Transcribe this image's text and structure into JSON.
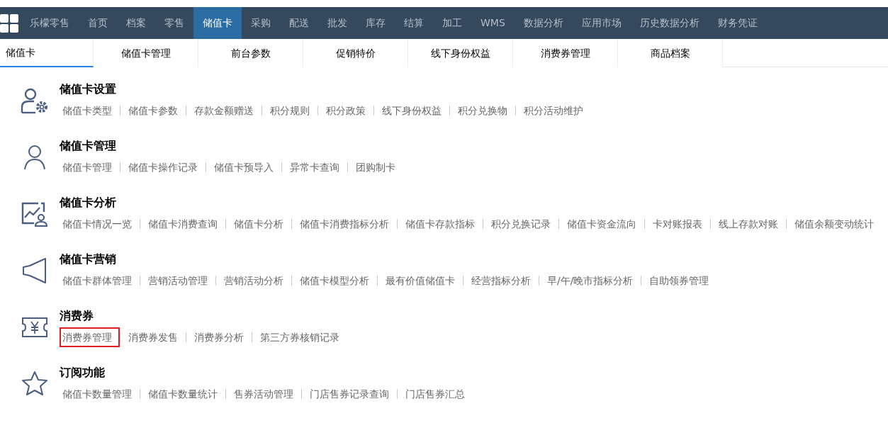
{
  "navbar": {
    "brand": "乐檬零售",
    "items": [
      {
        "label": "首页",
        "selected": false
      },
      {
        "label": "档案",
        "selected": false
      },
      {
        "label": "零售",
        "selected": false
      },
      {
        "label": "储值卡",
        "selected": true
      },
      {
        "label": "采购",
        "selected": false
      },
      {
        "label": "配送",
        "selected": false
      },
      {
        "label": "批发",
        "selected": false
      },
      {
        "label": "库存",
        "selected": false
      },
      {
        "label": "结算",
        "selected": false
      },
      {
        "label": "加工",
        "selected": false
      },
      {
        "label": "WMS",
        "selected": false
      },
      {
        "label": "数据分析",
        "selected": false
      },
      {
        "label": "应用市场",
        "selected": false
      },
      {
        "label": "历史数据分析",
        "selected": false
      },
      {
        "label": "财务凭证",
        "selected": false
      }
    ]
  },
  "tabs": [
    {
      "label": "储值卡",
      "selected": true
    },
    {
      "label": "储值卡管理",
      "selected": false
    },
    {
      "label": "前台参数",
      "selected": false
    },
    {
      "label": "促销特价",
      "selected": false
    },
    {
      "label": "线下身份权益",
      "selected": false
    },
    {
      "label": "消费券管理",
      "selected": false
    },
    {
      "label": "商品档案",
      "selected": false
    }
  ],
  "sections": [
    {
      "kind": "settings",
      "title": "储值卡设置",
      "links": [
        {
          "label": "储值卡类型",
          "highlighted": false
        },
        {
          "label": "储值卡参数",
          "highlighted": false
        },
        {
          "label": "存款金额赠送",
          "highlighted": false
        },
        {
          "label": "积分规则",
          "highlighted": false
        },
        {
          "label": "积分政策",
          "highlighted": false
        },
        {
          "label": "线下身份权益",
          "highlighted": false
        },
        {
          "label": "积分兑换物",
          "highlighted": false
        },
        {
          "label": "积分活动维护",
          "highlighted": false
        }
      ]
    },
    {
      "kind": "user",
      "title": "储值卡管理",
      "links": [
        {
          "label": "储值卡管理",
          "highlighted": false
        },
        {
          "label": "储值卡操作记录",
          "highlighted": false
        },
        {
          "label": "储值卡预导入",
          "highlighted": false
        },
        {
          "label": "异常卡查询",
          "highlighted": false
        },
        {
          "label": "团购制卡",
          "highlighted": false
        }
      ]
    },
    {
      "kind": "analysis",
      "title": "储值卡分析",
      "links": [
        {
          "label": "储值卡情况一览",
          "highlighted": false
        },
        {
          "label": "储值卡消费查询",
          "highlighted": false
        },
        {
          "label": "储值卡分析",
          "highlighted": false
        },
        {
          "label": "储值卡消费指标分析",
          "highlighted": false
        },
        {
          "label": "储值卡存款指标",
          "highlighted": false
        },
        {
          "label": "积分兑换记录",
          "highlighted": false
        },
        {
          "label": "储值卡资金流向",
          "highlighted": false
        },
        {
          "label": "卡对账报表",
          "highlighted": false
        },
        {
          "label": "线上存款对账",
          "highlighted": false
        },
        {
          "label": "储值余额变动统计",
          "highlighted": false
        }
      ]
    },
    {
      "kind": "marketing",
      "title": "储值卡营销",
      "links": [
        {
          "label": "储值卡群体管理",
          "highlighted": false
        },
        {
          "label": "营销活动管理",
          "highlighted": false
        },
        {
          "label": "营销活动分析",
          "highlighted": false
        },
        {
          "label": "储值卡模型分析",
          "highlighted": false
        },
        {
          "label": "最有价值储值卡",
          "highlighted": false
        },
        {
          "label": "经营指标分析",
          "highlighted": false
        },
        {
          "label": "早/午/晚市指标分析",
          "highlighted": false
        },
        {
          "label": "自助领券管理",
          "highlighted": false
        }
      ]
    },
    {
      "kind": "coupon",
      "title": "消费券",
      "links": [
        {
          "label": "消费券管理",
          "highlighted": true
        },
        {
          "label": "消费券发售",
          "highlighted": false
        },
        {
          "label": "消费券分析",
          "highlighted": false
        },
        {
          "label": "第三方券核销记录",
          "highlighted": false
        }
      ]
    },
    {
      "kind": "subscription",
      "title": "订阅功能",
      "links": [
        {
          "label": "储值卡数量管理",
          "highlighted": false
        },
        {
          "label": "储值卡数量统计",
          "highlighted": false
        },
        {
          "label": "售券活动管理",
          "highlighted": false
        },
        {
          "label": "门店售券记录查询",
          "highlighted": false
        },
        {
          "label": "门店售券汇总",
          "highlighted": false
        }
      ]
    }
  ]
}
